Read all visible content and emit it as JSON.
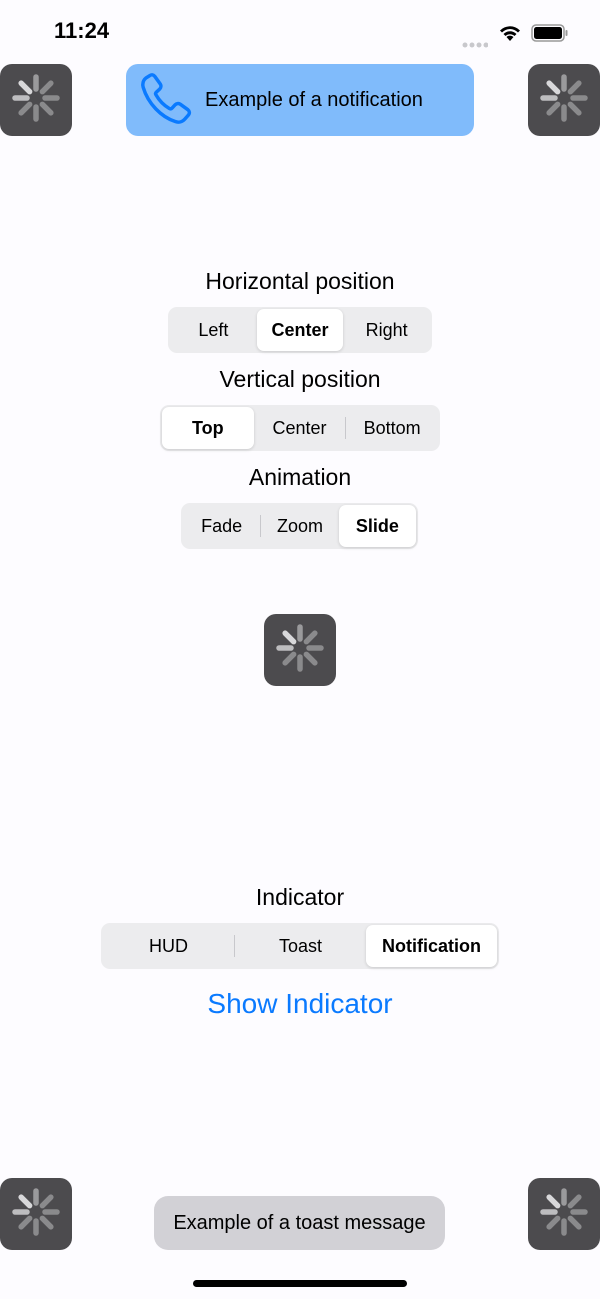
{
  "status_bar": {
    "time": "11:24"
  },
  "notification": {
    "text": "Example of a notification",
    "icon": "phone-icon",
    "color": "#80bbfb"
  },
  "horizontal": {
    "title": "Horizontal position",
    "options": [
      "Left",
      "Center",
      "Right"
    ],
    "selected": "Center"
  },
  "vertical": {
    "title": "Vertical position",
    "options": [
      "Top",
      "Center",
      "Bottom"
    ],
    "selected": "Top"
  },
  "animation": {
    "title": "Animation",
    "options": [
      "Fade",
      "Zoom",
      "Slide"
    ],
    "selected": "Slide"
  },
  "indicator": {
    "title": "Indicator",
    "options": [
      "HUD",
      "Toast",
      "Notification"
    ],
    "selected": "Notification"
  },
  "show_button": "Show Indicator",
  "toast": {
    "text": "Example of a toast message"
  },
  "accent": "#0a7aff"
}
